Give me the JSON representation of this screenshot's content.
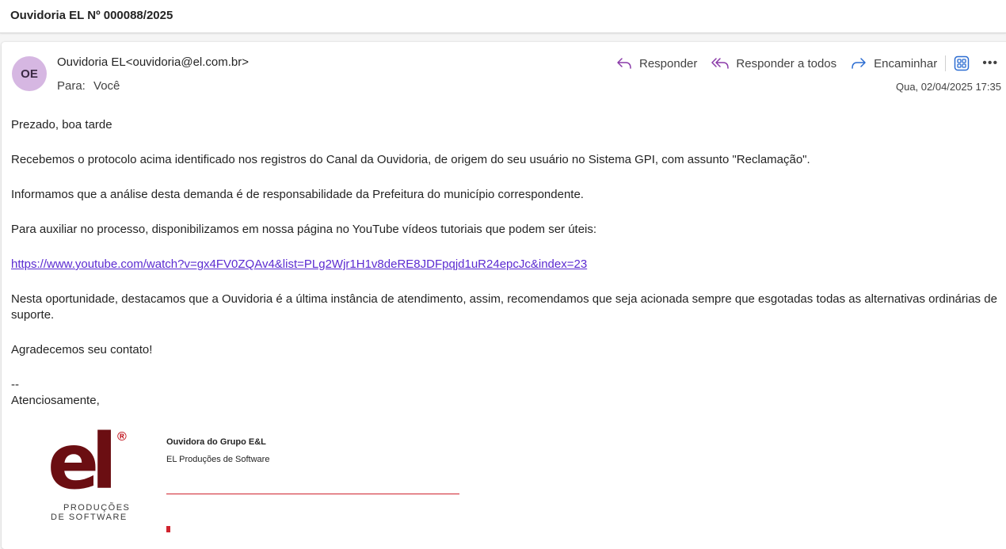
{
  "subject": "Ouvidoria EL Nº 000088/2025",
  "sender": {
    "initials": "OE",
    "name": "Ouvidoria EL",
    "email": "<ouvidoria@el.com.br>",
    "avatar_color": "#d6b7e2"
  },
  "recipient": {
    "label": "Para:",
    "value": "Você"
  },
  "actions": {
    "reply": "Responder",
    "reply_all": "Responder a todos",
    "forward": "Encaminhar",
    "apps_icon": "apps-icon",
    "more_icon": "more-icon"
  },
  "date": "Qua, 02/04/2025 17:35",
  "body": {
    "greeting": "Prezado, boa tarde",
    "p1": "Recebemos o protocolo acima identificado nos registros do Canal da Ouvidoria, de origem do seu usuário no Sistema GPI, com assunto \"Reclamação\".",
    "p2": "Informamos que a análise desta demanda é de responsabilidade da Prefeitura do município correspondente.",
    "p3": "Para auxiliar no processo, disponibilizamos em nossa página no YouTube vídeos tutoriais que podem ser úteis:",
    "link": "https://www.youtube.com/watch?v=gx4FV0ZQAv4&list=PLg2Wjr1H1v8deRE8JDFpqjd1uR24epcJc&index=23",
    "p4": "Nesta oportunidade, destacamos que a Ouvidoria é a última instância de atendimento, assim, recomendamos que seja acionada sempre que esgotadas todas as alternativas ordinárias de suporte.",
    "p5": "Agradecemos seu contato!",
    "sig_separator": "--",
    "closing": "Atenciosamente,"
  },
  "signature": {
    "logo_text": "el",
    "logo_registered": "®",
    "logo_line1": "PRODUÇÕES",
    "logo_line2": "DE SOFTWARE",
    "name": "Ouvidora do Grupo E&L",
    "company": "EL Produções de Software"
  },
  "colors": {
    "accent_purple": "#5b2bd1",
    "logo_dark_red": "#6b0e12",
    "logo_red": "#d0232e"
  }
}
